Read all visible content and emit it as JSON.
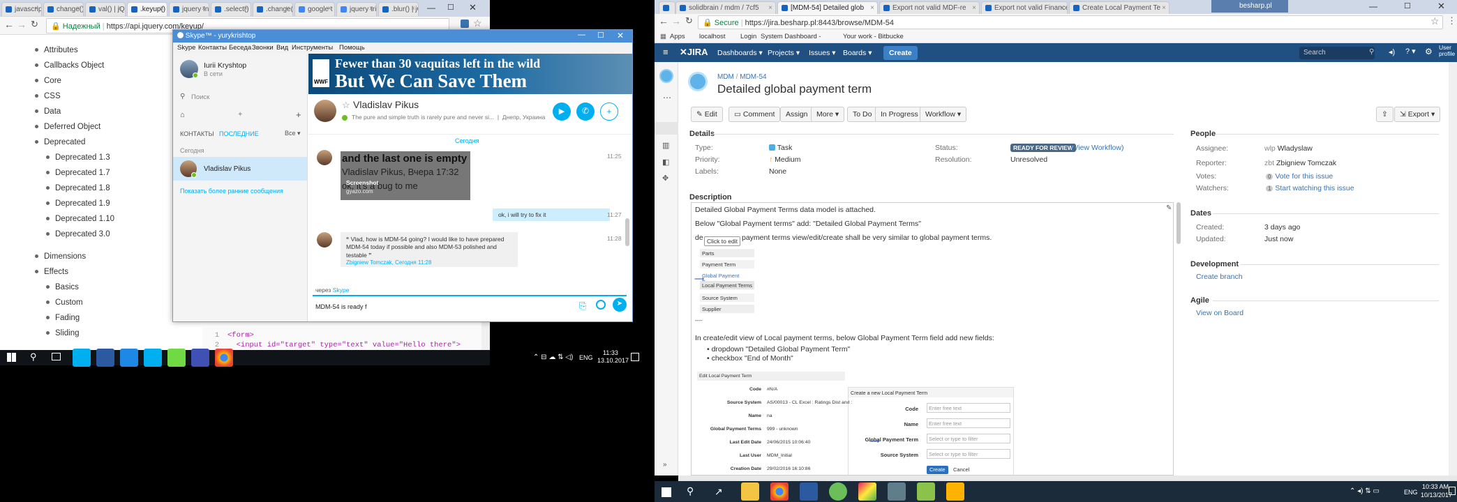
{
  "left_browser": {
    "tabs": [
      "javascrip",
      "change()",
      "val() | jQ",
      ".keyup()",
      "jquery In",
      ".select()",
      ".change()",
      "google t",
      "jquery tri",
      ".blur() | jQ"
    ],
    "secure_label": "Надежный",
    "url": "https://api.jquery.com/keyup/",
    "sidebar_items": [
      "Attributes",
      "Callbacks Object",
      "Core",
      "CSS",
      "Data",
      "Deferred Object",
      "Deprecated"
    ],
    "deprecated_children": [
      "Deprecated 1.3",
      "Deprecated 1.7",
      "Deprecated 1.8",
      "Deprecated 1.9",
      "Deprecated 1.10",
      "Deprecated 3.0"
    ],
    "sidebar_items2": [
      "Dimensions",
      "Effects"
    ],
    "effects_children": [
      "Basics",
      "Custom",
      "Fading",
      "Sliding"
    ],
    "code_lines": [
      {
        "num": "1",
        "text": "<form>"
      },
      {
        "num": "2",
        "text": "  <input id=\"target\" type=\"text\" value=\"Hello there\">"
      }
    ]
  },
  "skype": {
    "title": "Skype™ - yurykrishtop",
    "menu": [
      "Skype",
      "Контакты",
      "Беседа",
      "Звонки",
      "Вид",
      "Инструменты",
      "Помощь"
    ],
    "profile_name": "Iurii Kryshtop",
    "profile_status": "В сети",
    "search_placeholder": "Поиск",
    "tab_contacts": "КОНТАКТЫ",
    "tab_recent": "ПОСЛЕДНИЕ",
    "tab_all": "Все",
    "section_today": "Сегодня",
    "recent_contact": "Vladislav Pikus",
    "show_earlier": "Показать более ранние сообщения",
    "ad_line1": "Fewer than 30 vaquitas left in the wild",
    "ad_line2": "But We Can Save Them",
    "ad_logo": "WWF",
    "chat_name": "Vladislav Pikus",
    "chat_mood": "The pure and simple truth is rarely pure and never si...",
    "chat_location": "Днепр, Украина",
    "day_divider": "Сегодня",
    "screenshot_line1": "and the last one is empty",
    "screenshot_line2": "Vladislav Pikus, Вчера 17:32",
    "screenshot_line3": "ok, it's a bug to me",
    "screenshot_caption": "Screenshot",
    "screenshot_source": "gyazo.com",
    "time1": "11:25",
    "msg_out": "ok, i will try to fix it",
    "time2": "11:27",
    "quote_text": "Vlad, how is MDM-54 going? I would like to have prepared MDM-54 today if possible and also MDM-53 polished and testable",
    "quote_author": "Zbigniew Tomczak, Сегодня 11:28",
    "time3": "11:28",
    "via_label": "через",
    "via_link": "Skype",
    "input_value": "MDM-54 is ready f"
  },
  "left_taskbar": {
    "lang": "ENG",
    "time": "11:33",
    "date": "13.10.2017"
  },
  "right_browser": {
    "tabs": [
      "",
      "solidbrain / mdm / 7cf5",
      "[MDM-54] Detailed glob",
      "Export not valid MDF-re",
      "Export not valid Finance",
      "Create Local Payment Te"
    ],
    "window_user": "besharp.pl",
    "secure_label": "Secure",
    "url": "https://jira.besharp.pl:8443/browse/MDM-54",
    "bookmarks": [
      "Apps",
      "localhost",
      "Login",
      "System Dashboard -",
      "Your work - Bitbucke"
    ]
  },
  "jira": {
    "logo": "JIRA",
    "nav": [
      "Dashboards",
      "Projects",
      "Issues",
      "Boards"
    ],
    "create_label": "Create",
    "search_placeholder": "Search",
    "user_profile": "User profile",
    "breadcrumb_project": "MDM",
    "breadcrumb_issue": "MDM-54",
    "issue_title": "Detailed global payment term",
    "actions": [
      "Edit",
      "Comment",
      "Assign",
      "More",
      "To Do",
      "In Progress",
      "Workflow"
    ],
    "export_label": "Export",
    "details_heading": "Details",
    "details": {
      "type_label": "Type:",
      "type_value": "Task",
      "priority_label": "Priority:",
      "priority_value": "Medium",
      "labels_label": "Labels:",
      "labels_value": "None",
      "status_label": "Status:",
      "status_value": "READY FOR REVIEW",
      "status_link": "(View Workflow)",
      "resolution_label": "Resolution:",
      "resolution_value": "Unresolved"
    },
    "description_heading": "Description",
    "desc_lines": [
      "Detailed Global Payment Terms data model is attached.",
      "Below \"Global Payment terms\" add: \"Detailed Global Payment Terms\"",
      "payment terms view/edit/create shall be very similar to global payment terms."
    ],
    "desc_prefix": "de",
    "click_to_edit": "Click to edit",
    "mini_menu": [
      "Parts",
      "Payment Term",
      "Global Payment Terms",
      "Local Payment Terms",
      "Source System",
      "Supplier"
    ],
    "dashes": "----",
    "desc_line4": "In create/edit view of Local payment terms, below Global Payment Term field add new fields:",
    "desc_bullets": [
      "dropdown \"Detailed Global Payment Term\"",
      "checkbox \"End of Month\""
    ],
    "edit_form_title": "Edit Local Payment Term",
    "edit_form": [
      {
        "label": "Code",
        "value": "#N/A"
      },
      {
        "label": "Source System",
        "value": "AS/00013 - CL Excel : Ratings Dist and :"
      },
      {
        "label": "Name",
        "value": "na"
      },
      {
        "label": "Global Payment Terms",
        "value": "999 - unknown"
      },
      {
        "label": "Last Edit Date",
        "value": "24/06/2015 10:06:40"
      },
      {
        "label": "Last User",
        "value": "MDM_Initial"
      },
      {
        "label": "Creation Date",
        "value": "29/02/2016 16:10:86"
      }
    ],
    "create_form_title": "Create a new Local Payment Term",
    "create_form": [
      {
        "label": "Code",
        "value": "Enter free text"
      },
      {
        "label": "Name",
        "value": "Enter free text"
      },
      {
        "label": "Global Payment Term",
        "value": "Select or type to filter"
      },
      {
        "label": "Source System",
        "value": "Select or type to filter"
      }
    ],
    "create_btn": "Create",
    "cancel_btn": "Cancel",
    "people_heading": "People",
    "people": {
      "assignee_label": "Assignee:",
      "assignee_value": "Wladyslaw",
      "reporter_label": "Reporter:",
      "reporter_value": "Zbigniew Tomczak",
      "votes_label": "Votes:",
      "votes_value": "Vote for this issue",
      "votes_count": "0",
      "watchers_label": "Watchers:",
      "watchers_value": "Start watching this issue",
      "watchers_count": "1"
    },
    "dates_heading": "Dates",
    "dates": {
      "created_label": "Created:",
      "created_value": "3 days ago",
      "updated_label": "Updated:",
      "updated_value": "Just now"
    },
    "development_heading": "Development",
    "create_branch": "Create branch",
    "agile_heading": "Agile",
    "view_on_board": "View on Board"
  },
  "right_taskbar": {
    "lang": "ENG",
    "time": "10:33 AM",
    "date": "10/13/2017"
  }
}
